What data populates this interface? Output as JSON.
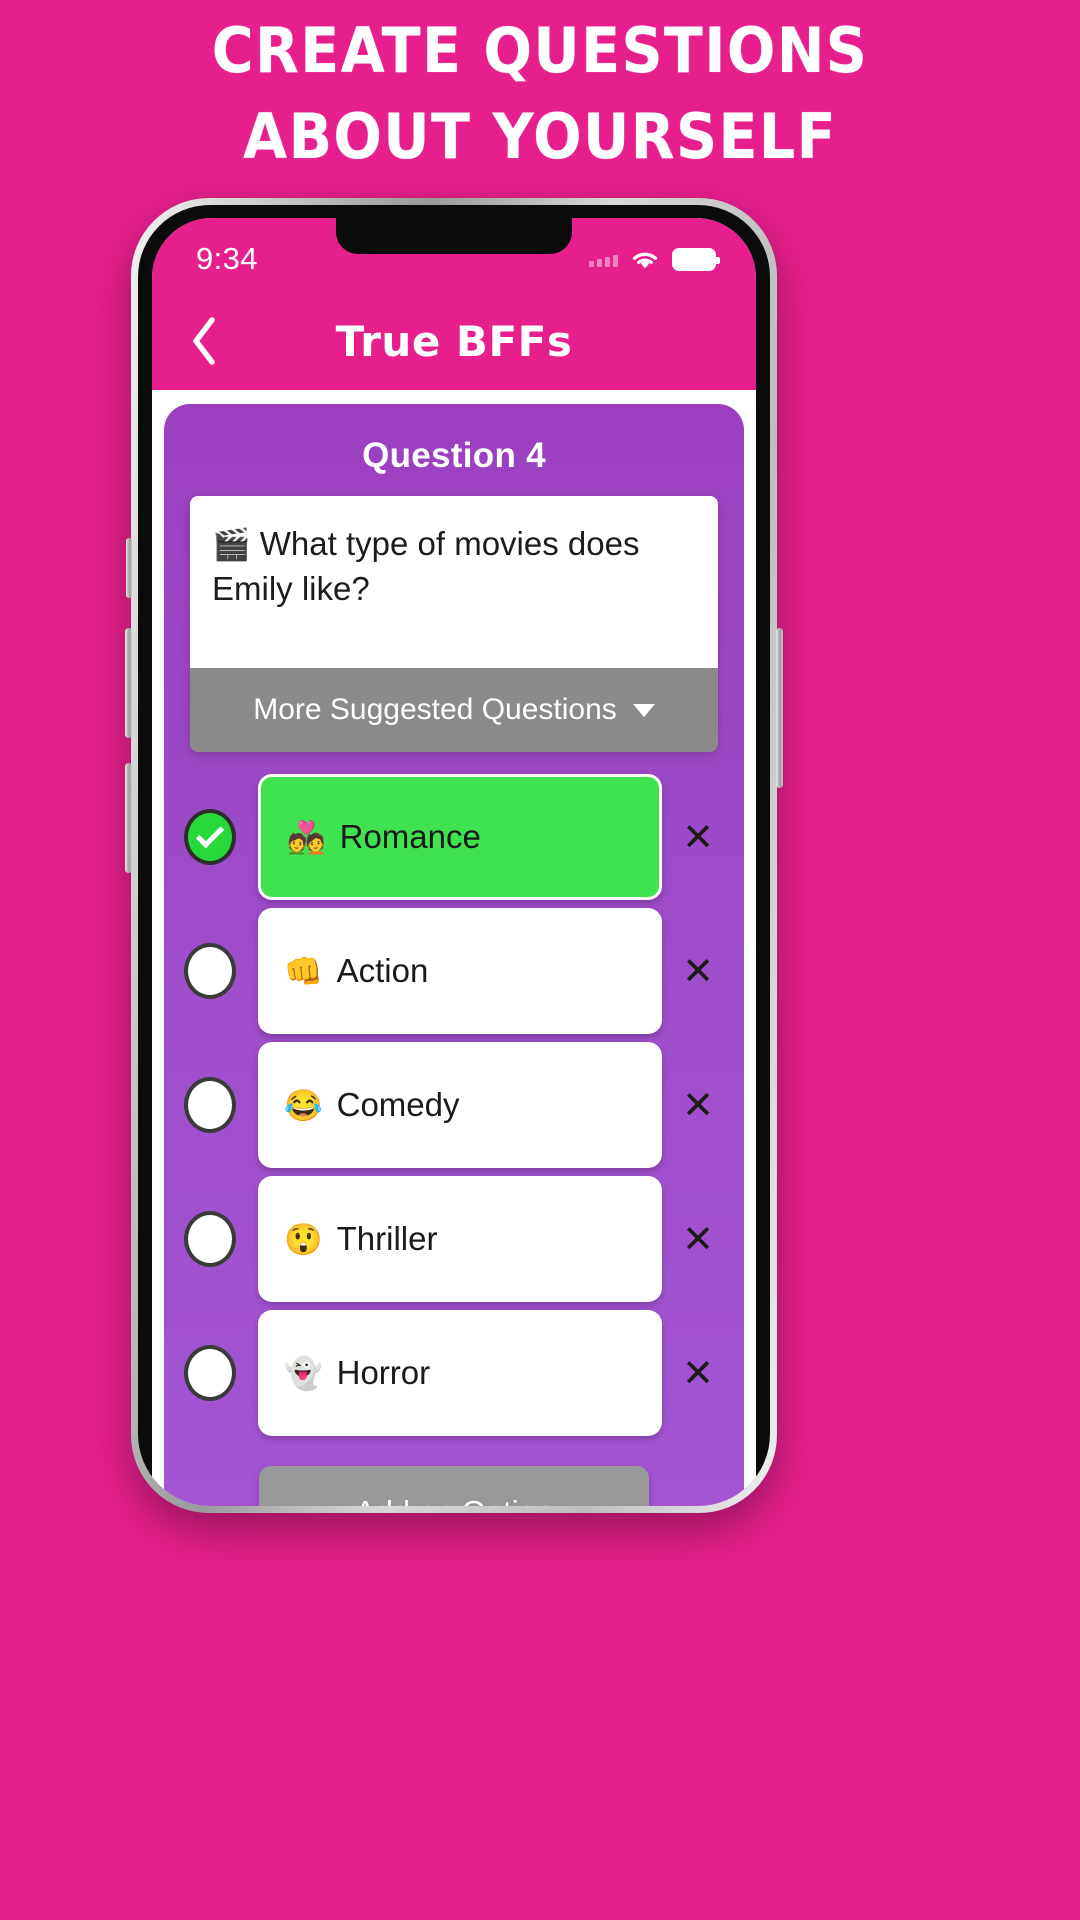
{
  "promo": {
    "headline": "Create Questions About Yourself"
  },
  "status_bar": {
    "time": "9:34",
    "signal_icon": "signal-bars-icon",
    "wifi_icon": "wifi-icon",
    "battery_icon": "battery-full-icon"
  },
  "header": {
    "back_icon": "back-chevron-icon",
    "title": "True BFFs",
    "background_color": "#e61f8d"
  },
  "question": {
    "number_label": "Question 4",
    "emoji": "🎬",
    "text": "What type of movies does Emily like?",
    "suggested_label": "More Suggested Questions",
    "suggested_caret_icon": "chevron-down-icon",
    "card_color": "#9f4ecc"
  },
  "options": [
    {
      "emoji": "💑",
      "label": "Romance",
      "selected": true,
      "delete_icon": "close-x-icon"
    },
    {
      "emoji": "👊",
      "label": "Action",
      "selected": false,
      "delete_icon": "close-x-icon"
    },
    {
      "emoji": "😂",
      "label": "Comedy",
      "selected": false,
      "delete_icon": "close-x-icon"
    },
    {
      "emoji": "😲",
      "label": "Thriller",
      "selected": false,
      "delete_icon": "close-x-icon"
    },
    {
      "emoji": "👻",
      "label": "Horror",
      "selected": false,
      "delete_icon": "close-x-icon"
    }
  ],
  "footer": {
    "add_option_label": "Add an Option"
  },
  "colors": {
    "brand_pink": "#e61f8d",
    "card_purple": "#9f4ecc",
    "selected_green": "#3fe34f",
    "gray_button": "#8a8a8a"
  }
}
